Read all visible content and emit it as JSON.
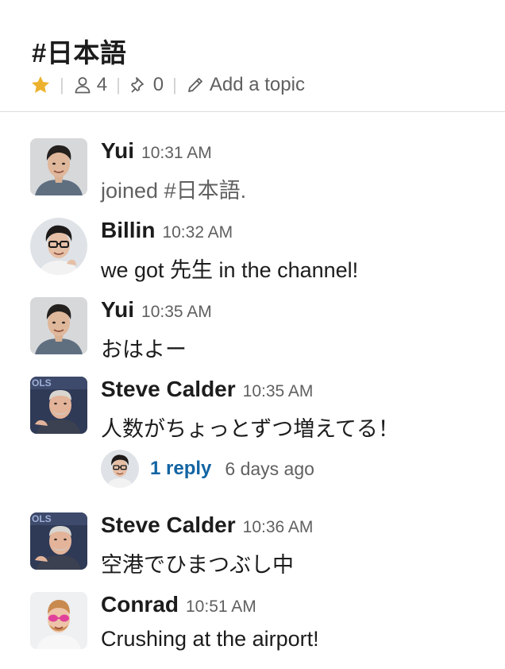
{
  "header": {
    "channel_name": "#日本語",
    "member_count": "4",
    "pinned_count": "0",
    "add_topic_label": "Add a topic"
  },
  "messages": [
    {
      "sender": "Yui",
      "time": "10:31 AM",
      "text": "joined #日本語.",
      "avatar": "yui-avatar"
    },
    {
      "sender": "Billin",
      "time": "10:32 AM",
      "text": "we got 先生 in the channel!",
      "avatar": "billin-avatar"
    },
    {
      "sender": "Yui",
      "time": "10:35 AM",
      "text": "おはよー",
      "avatar": "yui-avatar"
    },
    {
      "sender": "Steve Calder",
      "time": "10:35 AM",
      "text": "人数がちょっとずつ増えてる！",
      "avatar": "steve-avatar",
      "thread": {
        "reply_count": "1 reply",
        "last_reply": "6 days ago"
      }
    },
    {
      "sender": "Steve Calder",
      "time": "10:36 AM",
      "text": "空港でひまつぶし中",
      "avatar": "steve-avatar"
    },
    {
      "sender": "Conrad",
      "time": "10:51 AM",
      "text": "Crushing at the airport!",
      "avatar": "conrad-avatar"
    }
  ],
  "colors": {
    "link": "#1264a3",
    "star": "#ecb22e",
    "muted": "#616061",
    "text": "#1d1c1d"
  }
}
